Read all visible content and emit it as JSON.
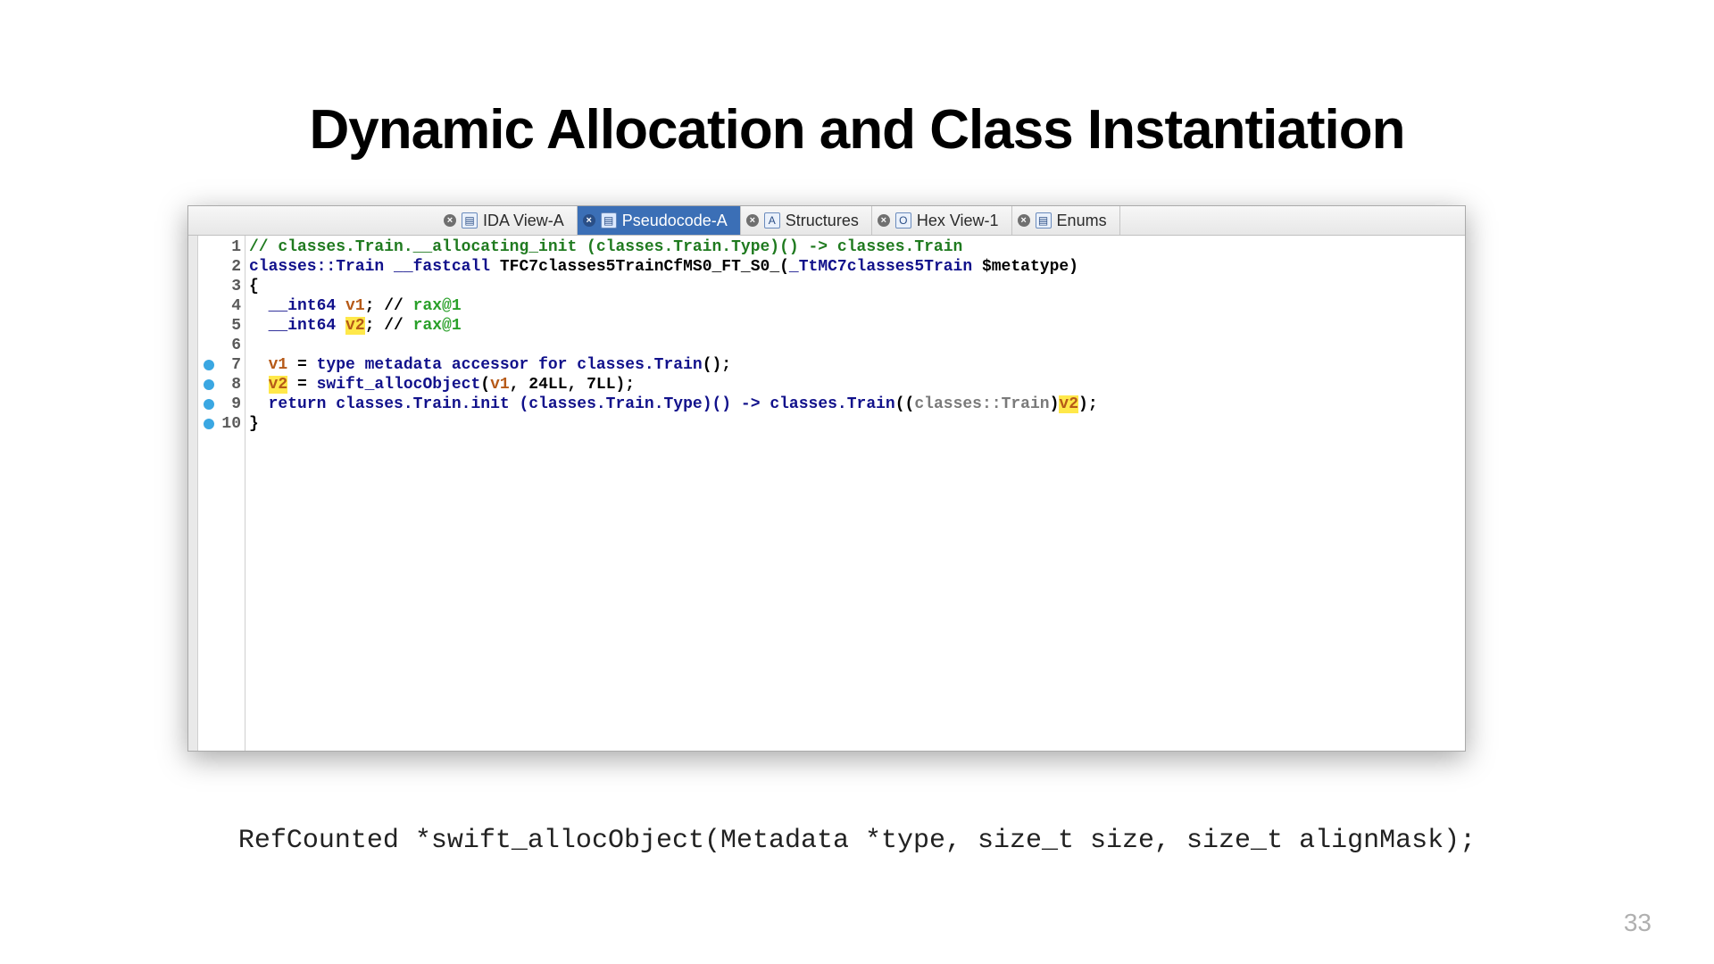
{
  "title": "Dynamic Allocation and Class Instantiation",
  "tabs": {
    "ida": "IDA View-A",
    "pseudo": "Pseudocode-A",
    "structs": "Structures",
    "hex": "Hex View-1",
    "enums": "Enums"
  },
  "lines": [
    "1",
    "2",
    "3",
    "4",
    "5",
    "6",
    "7",
    "8",
    "9",
    "10"
  ],
  "code": {
    "l1_comment": "// classes.Train.__allocating_init (classes.Train.Type)() -> classes.Train",
    "l2_a": "classes::Train ",
    "l2_b": "__fastcall",
    "l2_c": " TFC7classes5TrainCfMS0_FT_S0_(",
    "l2_d": "_TtMC7classes5Train",
    "l2_e": " $metatype)",
    "l3": "{",
    "l4_a": "  __int64 ",
    "l4_b": "v1",
    "l4_c": "; // ",
    "l4_d": "rax@1",
    "l5_a": "  __int64 ",
    "l5_b": "v2",
    "l5_c": "; // ",
    "l5_d": "rax@1",
    "l7_a": "  ",
    "l7_b": "v1",
    "l7_c": " = ",
    "l7_d": "type metadata accessor for classes.Train",
    "l7_e": "();",
    "l8_a": "  ",
    "l8_b": "v2",
    "l8_c": " = ",
    "l8_d": "swift_allocObject",
    "l8_e": "(",
    "l8_f": "v1",
    "l8_g": ", 24LL, 7LL);",
    "l9_a": "  ",
    "l9_b": "return",
    "l9_c": " ",
    "l9_d": "classes.Train.init (classes.Train.Type)() -> classes.Train",
    "l9_e": "((",
    "l9_f": "classes::Train",
    "l9_g": ")",
    "l9_h": "v2",
    "l9_i": ");",
    "l10": "}"
  },
  "caption": "RefCounted *swift_allocObject(Metadata *type, size_t size, size_t alignMask);",
  "page": "33"
}
